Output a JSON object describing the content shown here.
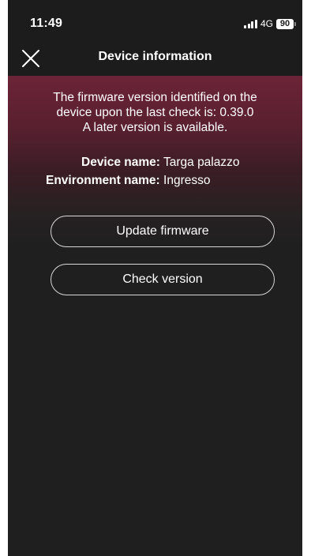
{
  "status_bar": {
    "time": "11:49",
    "network": "4G",
    "battery": "90"
  },
  "header": {
    "title": "Device information",
    "close_icon": "close-icon"
  },
  "message": {
    "line1": "The firmware version identified on the",
    "line2": "device upon the last check is: 0.39.0",
    "line3": "A later version is available."
  },
  "device": {
    "name_label": "Device name:",
    "name_value": "Targa palazzo",
    "environment_label": "Environment name:",
    "environment_value": "Ingresso"
  },
  "buttons": {
    "update_label": "Update firmware",
    "check_label": "Check version"
  },
  "colors": {
    "background": "#1f1f1f",
    "banner": "#6b2437",
    "text": "#ffffff"
  }
}
